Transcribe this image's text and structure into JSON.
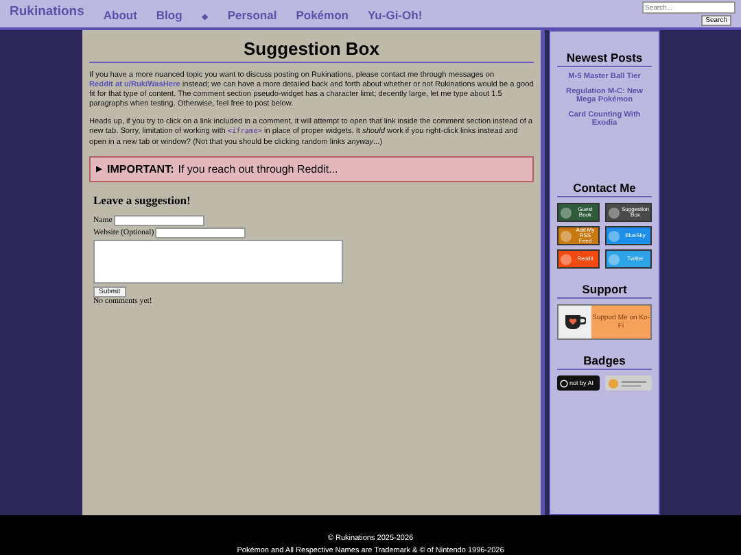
{
  "header": {
    "site_title": "Rukinations",
    "nav": [
      {
        "label": "About",
        "kind": "link"
      },
      {
        "label": "Blog",
        "kind": "link"
      },
      {
        "label": "◆",
        "kind": "separator"
      },
      {
        "label": "Personal",
        "kind": "link"
      },
      {
        "label": "Pokémon",
        "kind": "link"
      },
      {
        "label": "Yu-Gi-Oh!",
        "kind": "link"
      }
    ],
    "search": {
      "placeholder": "Search...",
      "button": "Search"
    }
  },
  "main": {
    "title": "Suggestion Box",
    "paragraphs": [
      [
        {
          "kind": "text",
          "text": "If you have a more nuanced topic you want to discuss posting on Rukinations, please contact me through messages on "
        },
        {
          "kind": "link",
          "text": "Reddit at u/RukiWasHere"
        },
        {
          "kind": "text",
          "text": " instead; we can have a more detailed back and forth about whether or not Rukinations would be a good fit for that type of content. The comment section pseudo-widget has a character limit; decently large, let me type about 1.5 paragraphs when testing. Otherwise, feel free to post below."
        }
      ],
      [
        {
          "kind": "text",
          "text": "Heads up, if you try to click on a link included in a comment, it will attempt to open that link inside the comment section instead of a new tab. Sorry, limitation of working with "
        },
        {
          "kind": "code",
          "text": "<iframe>"
        },
        {
          "kind": "text",
          "text": " in place of proper widgets. It *should* work if you right-click links instead and open in a new tab or window? (Not that you should be clicking random links *anyway*...)"
        }
      ]
    ],
    "details": {
      "marker": "▶",
      "label": "IMPORTANT:",
      "text": "If you reach out through Reddit..."
    },
    "form": {
      "heading": "Leave a suggestion!",
      "fields": [
        {
          "label": "Name"
        },
        {
          "label": "Website (Optional)"
        }
      ],
      "submit": "Submit",
      "status": "No comments yet!"
    }
  },
  "sidebar": {
    "newest_posts": {
      "title": "Newest Posts",
      "items": [
        "M-5 Master Ball Tier",
        "Regulation M-C: New Mega Pokémon",
        "Card Counting With Exodia"
      ]
    },
    "contact": {
      "title": "Contact Me",
      "buttons": [
        {
          "label": "Guest Book",
          "color": "#2f5a3c"
        },
        {
          "label": "Suggestion Box",
          "color": "#4a4a4a"
        },
        {
          "label": "Add My RSS Feed",
          "color": "#c87a10"
        },
        {
          "label": "BlueSky",
          "color": "#1e8fe8"
        },
        {
          "label": "Reddit",
          "color": "#f04a12"
        },
        {
          "label": "Twitter",
          "color": "#2ea3e8"
        }
      ]
    },
    "support": {
      "title": "Support",
      "button": "Support Me on Ko-Fi"
    },
    "badges": {
      "title": "Badges",
      "items": [
        {
          "label": "not by AI",
          "kind": "notbyai"
        },
        {
          "kind": "neocities"
        }
      ]
    }
  },
  "footer": {
    "lines": [
      "© Rukinations 2025-2026",
      "Pokémon and All Respective Names are Trademark & © of Nintendo 1996-2026"
    ]
  }
}
